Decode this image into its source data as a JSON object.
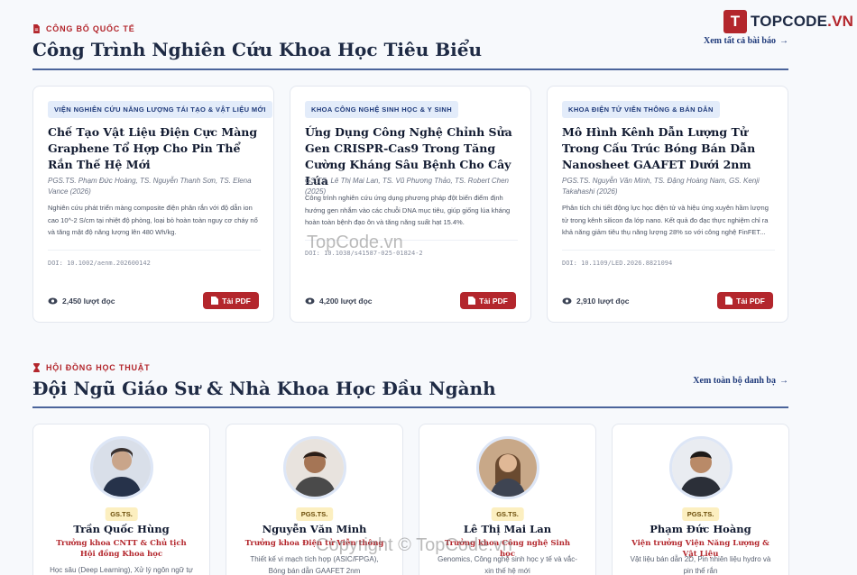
{
  "logo": {
    "mark": "T",
    "text_main": "TOPCODE",
    "text_tld": ".VN"
  },
  "publications": {
    "eyebrow": "CÔNG BỐ QUỐC TẾ",
    "title": "Công Trình Nghiên Cứu Khoa Học Tiêu Biểu",
    "see_all": "Xem tất cả bài báo",
    "cards": [
      {
        "tag": "VIỆN NGHIÊN CỨU NĂNG LƯỢNG TÁI TẠO & VẬT LIỆU MỚI",
        "title": "Chế Tạo Vật Liệu Điện Cực Màng Graphene Tổ Hợp Cho Pin Thể Rắn Thế Hệ Mới",
        "authors": "PGS.TS. Phạm Đức Hoàng, TS. Nguyễn Thanh Sơn, TS. Elena Vance (2026)",
        "abstract": "Nghiên cứu phát triển màng composite điện phân rắn với độ dẫn ion cao 10^-2 S/cm tại nhiệt độ phòng, loại bỏ hoàn toàn nguy cơ cháy nổ và tăng mật độ năng lượng lên 480 Wh/kg.",
        "doi": "DOI: 10.1002/aenm.202600142",
        "views": "2,450 lượt đọc",
        "pdf": "Tải PDF"
      },
      {
        "tag": "KHOA CÔNG NGHỆ SINH HỌC & Y SINH",
        "title": "Ứng Dụng Công Nghệ Chỉnh Sửa Gen CRISPR-Cas9 Trong Tăng Cường Kháng Sâu Bệnh Cho Cây Lúa",
        "authors": "GS.TS. Lê Thị Mai Lan, TS. Vũ Phương Thảo, TS. Robert Chen (2025)",
        "abstract": "Công trình nghiên cứu ứng dụng phương pháp đột biến điểm định hướng gen nhắm vào các chuỗi DNA mục tiêu, giúp giống lúa kháng hoàn toàn bệnh đạo ôn và tăng năng suất hạt 15.4%.",
        "doi": "DOI: 10.1038/s41587-025-01824-2",
        "views": "4,200 lượt đọc",
        "pdf": "Tải PDF"
      },
      {
        "tag": "KHOA ĐIỆN TỬ VIỄN THÔNG & BÁN DẪN",
        "title": "Mô Hình Kênh Dẫn Lượng Tử Trong Cấu Trúc Bóng Bán Dẫn Nanosheet GAAFET Dưới 2nm",
        "authors": "PGS.TS. Nguyễn Văn Minh, TS. Đặng Hoàng Nam, GS. Kenji Takahashi (2026)",
        "abstract": "Phân tích chi tiết động lực học điện tử và hiệu ứng xuyên hầm lượng tử trong kênh silicon đa lớp nano. Kết quả đo đạc thực nghiệm chỉ ra khả năng giảm tiêu thụ năng lượng 28% so với công nghệ FinFET...",
        "doi": "DOI: 10.1109/LED.2026.8821094",
        "views": "2,910 lượt đọc",
        "pdf": "Tải PDF"
      }
    ]
  },
  "council": {
    "eyebrow": "HỘI ĐỒNG HỌC THUẬT",
    "title": "Đội Ngũ Giáo Sư & Nhà Khoa Học Đầu Ngành",
    "see_all": "Xem toàn bộ danh bạ",
    "members": [
      {
        "rank": "GS.TS.",
        "name": "Trần Quốc Hùng",
        "role": "Trưởng khoa CNTT & Chủ tịch Hội đồng Khoa học",
        "desc": "Học sâu (Deep Learning), Xử lý ngôn ngữ tự"
      },
      {
        "rank": "PGS.TS.",
        "name": "Nguyễn Văn Minh",
        "role": "Trưởng khoa Điện tử Viễn thông",
        "desc": "Thiết kế vi mạch tích hợp (ASIC/FPGA), Bóng bán dẫn GAAFET 2nm"
      },
      {
        "rank": "GS.TS.",
        "name": "Lê Thị Mai Lan",
        "role": "Trưởng khoa Công nghệ Sinh học",
        "desc": "Genomics, Công nghệ sinh học y tế và vắc-xin thế hệ mới"
      },
      {
        "rank": "PGS.TS.",
        "name": "Phạm Đức Hoàng",
        "role": "Viện trưởng Viện Năng Lượng & Vật Liệu",
        "desc": "Vật liệu bán dẫn 2D, Pin nhiên liệu hydro và pin thể rắn"
      }
    ]
  },
  "watermarks": {
    "center": "TopCode.vn",
    "bottom": "Copyright © TopCode.vn"
  },
  "colors": {
    "accent": "#b3262c",
    "navy": "#1f3a7a",
    "rank_bg": "#fcefc0"
  }
}
